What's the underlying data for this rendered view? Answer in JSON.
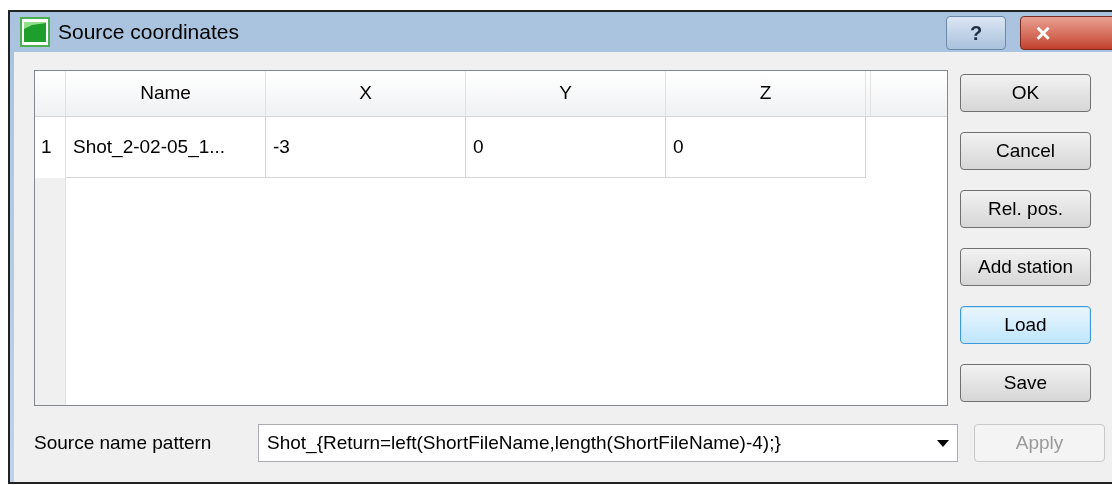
{
  "window": {
    "title": "Source coordinates",
    "help": "?",
    "close": "×"
  },
  "table": {
    "columns": [
      "Name",
      "X",
      "Y",
      "Z"
    ],
    "rows": [
      {
        "number": "1",
        "cells": [
          "Shot_2-02-05_1...",
          "-3",
          "0",
          "0"
        ]
      }
    ]
  },
  "buttons": [
    {
      "label": "OK",
      "focused": false,
      "disabled": false
    },
    {
      "label": "Cancel",
      "focused": false,
      "disabled": false
    },
    {
      "label": "Rel. pos.",
      "focused": false,
      "disabled": false
    },
    {
      "label": "Add station",
      "focused": false,
      "disabled": false
    },
    {
      "label": "Load",
      "focused": true,
      "disabled": false
    },
    {
      "label": "Save",
      "focused": false,
      "disabled": false
    }
  ],
  "pattern": {
    "label": "Source name pattern",
    "value": "Shot_{Return=left(ShortFileName,length(ShortFileName)-4);}",
    "apply": {
      "label": "Apply",
      "disabled": true
    }
  }
}
